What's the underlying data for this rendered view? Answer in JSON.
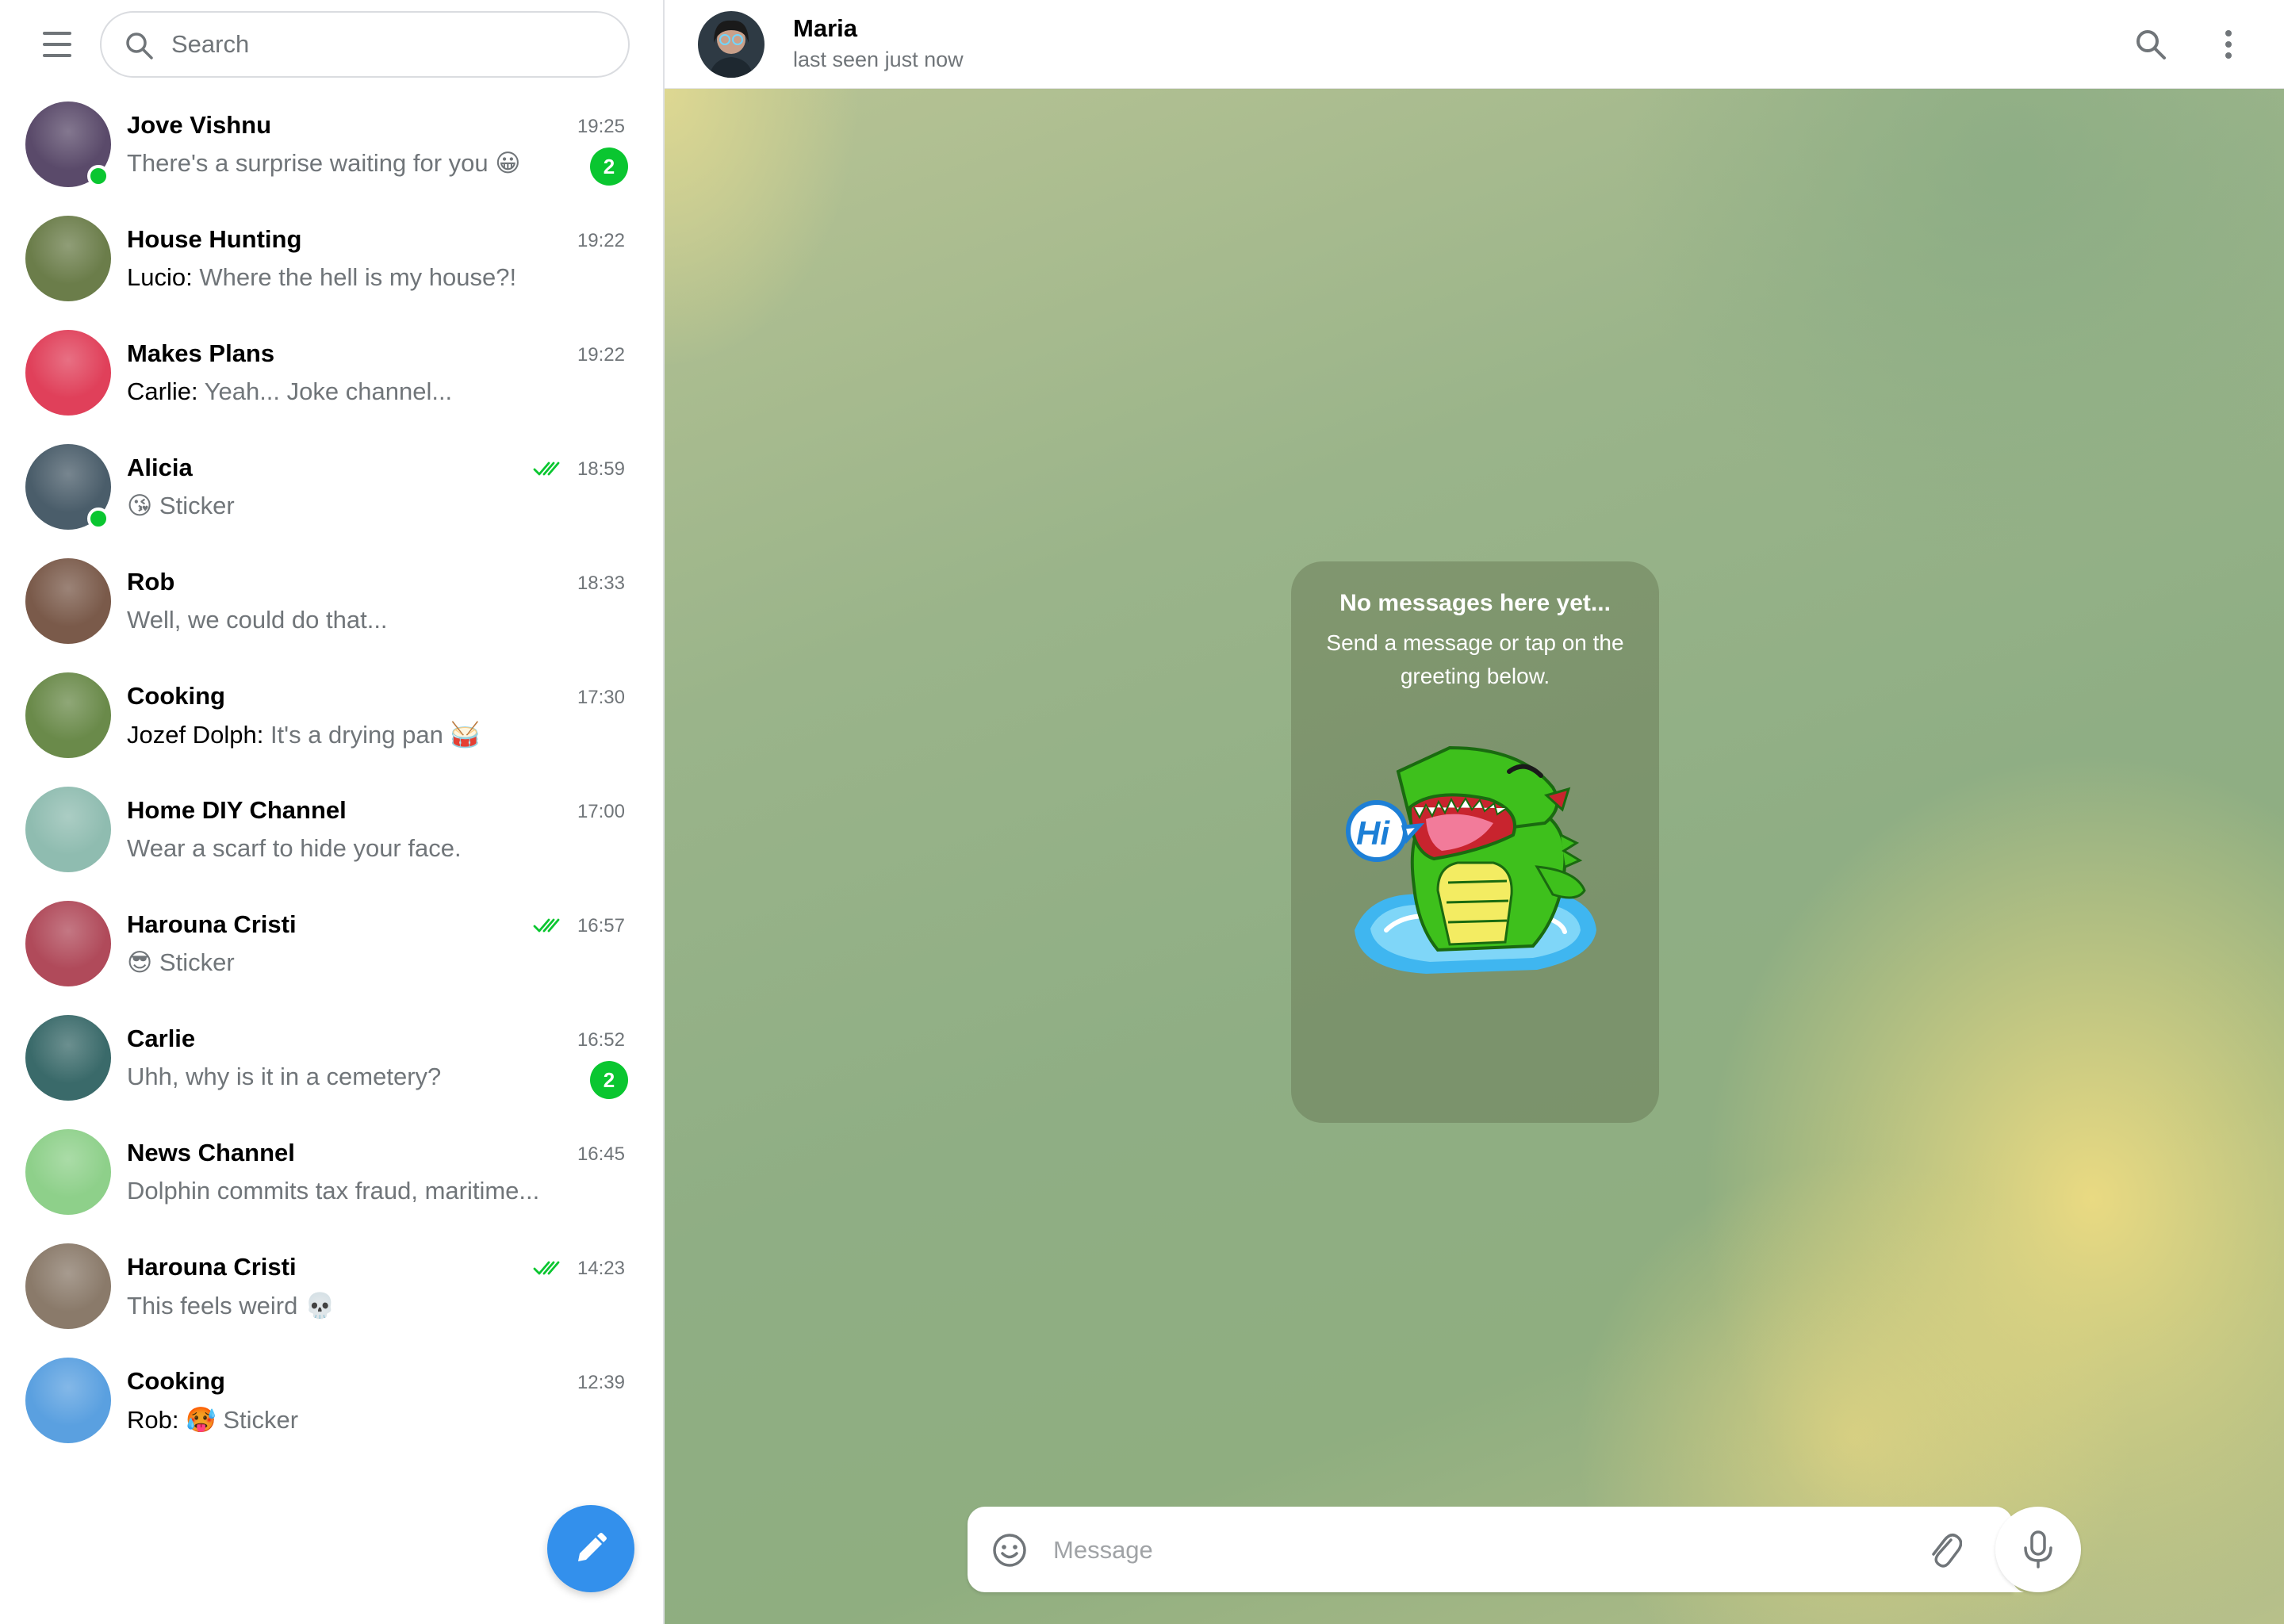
{
  "sidebar": {
    "search_placeholder": "Search",
    "chats": [
      {
        "name": "Jove Vishnu",
        "time": "19:25",
        "sender": "",
        "preview": "There's a surprise waiting for you 😀",
        "unread": "2",
        "online": true,
        "read": false,
        "avatar_color": "#5a4a6a"
      },
      {
        "name": "House Hunting",
        "time": "19:22",
        "sender": "Lucio: ",
        "preview": "Where the hell is my house?!",
        "unread": "",
        "online": false,
        "read": false,
        "avatar_color": "#6b7d4a"
      },
      {
        "name": "Makes Plans",
        "time": "19:22",
        "sender": "Carlie: ",
        "preview": "Yeah... Joke channel...",
        "unread": "",
        "online": false,
        "read": false,
        "avatar_color": "#e0405a"
      },
      {
        "name": "Alicia",
        "time": "18:59",
        "sender": "",
        "preview": "😘 Sticker",
        "unread": "",
        "online": true,
        "read": true,
        "avatar_color": "#4a5d6a"
      },
      {
        "name": "Rob",
        "time": "18:33",
        "sender": "",
        "preview": "Well, we could do that...",
        "unread": "",
        "online": false,
        "read": false,
        "avatar_color": "#7a5a4a"
      },
      {
        "name": "Cooking",
        "time": "17:30",
        "sender": "Jozef Dolph: ",
        "preview": "It's a drying pan 🥁",
        "unread": "",
        "online": false,
        "read": false,
        "avatar_color": "#6a8a4a"
      },
      {
        "name": "Home DIY Channel",
        "time": "17:00",
        "sender": "",
        "preview": "Wear a scarf to hide your face.",
        "unread": "",
        "online": false,
        "read": false,
        "avatar_color": "#8fbcb0"
      },
      {
        "name": "Harouna Cristi",
        "time": "16:57",
        "sender": "",
        "preview": "😎 Sticker",
        "unread": "",
        "online": false,
        "read": true,
        "avatar_color": "#b04a5a"
      },
      {
        "name": "Carlie",
        "time": "16:52",
        "sender": "",
        "preview": "Uhh, why is it in a cemetery?",
        "unread": "2",
        "online": false,
        "read": false,
        "avatar_color": "#3a6a6a"
      },
      {
        "name": "News Channel",
        "time": "16:45",
        "sender": "",
        "preview": "Dolphin commits tax fraud, maritime...",
        "unread": "",
        "online": false,
        "read": false,
        "avatar_color": "#8ed08a"
      },
      {
        "name": "Harouna Cristi",
        "time": "14:23",
        "sender": "",
        "preview": "This feels weird 💀",
        "unread": "",
        "online": false,
        "read": true,
        "avatar_color": "#8a7a6a"
      },
      {
        "name": "Cooking",
        "time": "12:39",
        "sender": "Rob: ",
        "preview": "🥵 Sticker",
        "unread": "",
        "online": false,
        "read": false,
        "avatar_color": "#5aa0e0"
      }
    ]
  },
  "header": {
    "name": "Maria",
    "status": "last seen just now"
  },
  "empty_state": {
    "title": "No messages here yet...",
    "subtitle": "Send a message or tap on the greeting below.",
    "sticker_text": "Hi"
  },
  "composer": {
    "placeholder": "Message"
  },
  "colors": {
    "accent": "#3390ec",
    "unread_badge": "#0ac630",
    "online": "#0ac630",
    "read_check": "#0ac630"
  }
}
